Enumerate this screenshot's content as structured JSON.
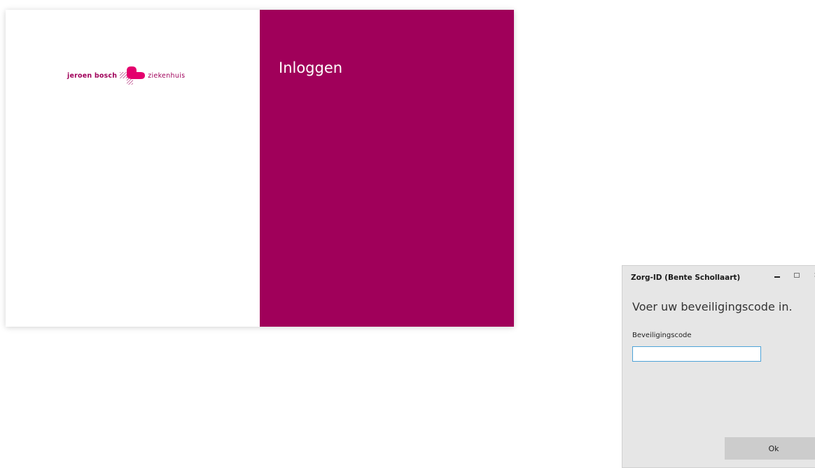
{
  "colors": {
    "brand": "#a0005a",
    "brand_light": "#e4006d",
    "dialog_background": "#e6e6e6",
    "input_border": "#4ea3d8"
  },
  "login_panel": {
    "logo": {
      "left_text": "Jeroen Bosch",
      "right_text": "ziekenhuis",
      "icon": "heart-cross-logo-icon"
    },
    "title": "Inloggen"
  },
  "dialog": {
    "title": "Zorg-ID (Bente Schollaart)",
    "controls": {
      "minimize_icon": "minimize-icon",
      "maximize_icon": "maximize-icon",
      "close_label": "×"
    },
    "heading": "Voer uw beveiligingscode in.",
    "field_label": "Beveiligingscode",
    "field_value": "",
    "field_placeholder": "",
    "ok_label": "Ok"
  }
}
